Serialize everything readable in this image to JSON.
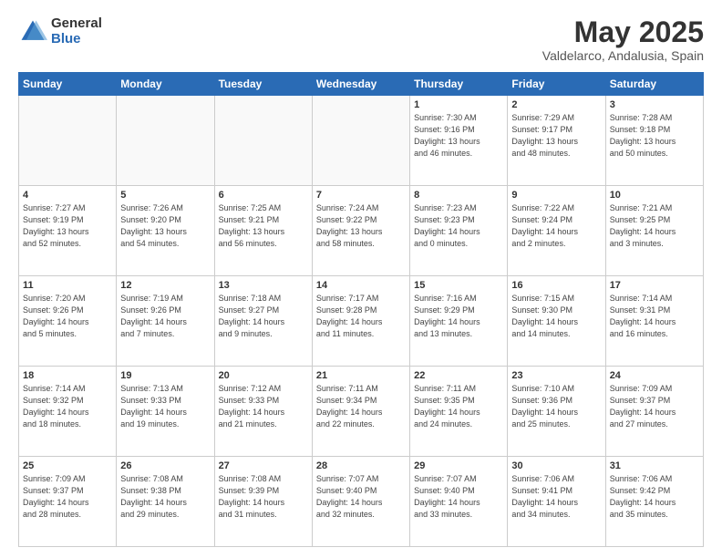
{
  "header": {
    "logo_general": "General",
    "logo_blue": "Blue",
    "title": "May 2025",
    "location": "Valdelarco, Andalusia, Spain"
  },
  "days_of_week": [
    "Sunday",
    "Monday",
    "Tuesday",
    "Wednesday",
    "Thursday",
    "Friday",
    "Saturday"
  ],
  "weeks": [
    [
      {
        "day": "",
        "info": ""
      },
      {
        "day": "",
        "info": ""
      },
      {
        "day": "",
        "info": ""
      },
      {
        "day": "",
        "info": ""
      },
      {
        "day": "1",
        "info": "Sunrise: 7:30 AM\nSunset: 9:16 PM\nDaylight: 13 hours\nand 46 minutes."
      },
      {
        "day": "2",
        "info": "Sunrise: 7:29 AM\nSunset: 9:17 PM\nDaylight: 13 hours\nand 48 minutes."
      },
      {
        "day": "3",
        "info": "Sunrise: 7:28 AM\nSunset: 9:18 PM\nDaylight: 13 hours\nand 50 minutes."
      }
    ],
    [
      {
        "day": "4",
        "info": "Sunrise: 7:27 AM\nSunset: 9:19 PM\nDaylight: 13 hours\nand 52 minutes."
      },
      {
        "day": "5",
        "info": "Sunrise: 7:26 AM\nSunset: 9:20 PM\nDaylight: 13 hours\nand 54 minutes."
      },
      {
        "day": "6",
        "info": "Sunrise: 7:25 AM\nSunset: 9:21 PM\nDaylight: 13 hours\nand 56 minutes."
      },
      {
        "day": "7",
        "info": "Sunrise: 7:24 AM\nSunset: 9:22 PM\nDaylight: 13 hours\nand 58 minutes."
      },
      {
        "day": "8",
        "info": "Sunrise: 7:23 AM\nSunset: 9:23 PM\nDaylight: 14 hours\nand 0 minutes."
      },
      {
        "day": "9",
        "info": "Sunrise: 7:22 AM\nSunset: 9:24 PM\nDaylight: 14 hours\nand 2 minutes."
      },
      {
        "day": "10",
        "info": "Sunrise: 7:21 AM\nSunset: 9:25 PM\nDaylight: 14 hours\nand 3 minutes."
      }
    ],
    [
      {
        "day": "11",
        "info": "Sunrise: 7:20 AM\nSunset: 9:26 PM\nDaylight: 14 hours\nand 5 minutes."
      },
      {
        "day": "12",
        "info": "Sunrise: 7:19 AM\nSunset: 9:26 PM\nDaylight: 14 hours\nand 7 minutes."
      },
      {
        "day": "13",
        "info": "Sunrise: 7:18 AM\nSunset: 9:27 PM\nDaylight: 14 hours\nand 9 minutes."
      },
      {
        "day": "14",
        "info": "Sunrise: 7:17 AM\nSunset: 9:28 PM\nDaylight: 14 hours\nand 11 minutes."
      },
      {
        "day": "15",
        "info": "Sunrise: 7:16 AM\nSunset: 9:29 PM\nDaylight: 14 hours\nand 13 minutes."
      },
      {
        "day": "16",
        "info": "Sunrise: 7:15 AM\nSunset: 9:30 PM\nDaylight: 14 hours\nand 14 minutes."
      },
      {
        "day": "17",
        "info": "Sunrise: 7:14 AM\nSunset: 9:31 PM\nDaylight: 14 hours\nand 16 minutes."
      }
    ],
    [
      {
        "day": "18",
        "info": "Sunrise: 7:14 AM\nSunset: 9:32 PM\nDaylight: 14 hours\nand 18 minutes."
      },
      {
        "day": "19",
        "info": "Sunrise: 7:13 AM\nSunset: 9:33 PM\nDaylight: 14 hours\nand 19 minutes."
      },
      {
        "day": "20",
        "info": "Sunrise: 7:12 AM\nSunset: 9:33 PM\nDaylight: 14 hours\nand 21 minutes."
      },
      {
        "day": "21",
        "info": "Sunrise: 7:11 AM\nSunset: 9:34 PM\nDaylight: 14 hours\nand 22 minutes."
      },
      {
        "day": "22",
        "info": "Sunrise: 7:11 AM\nSunset: 9:35 PM\nDaylight: 14 hours\nand 24 minutes."
      },
      {
        "day": "23",
        "info": "Sunrise: 7:10 AM\nSunset: 9:36 PM\nDaylight: 14 hours\nand 25 minutes."
      },
      {
        "day": "24",
        "info": "Sunrise: 7:09 AM\nSunset: 9:37 PM\nDaylight: 14 hours\nand 27 minutes."
      }
    ],
    [
      {
        "day": "25",
        "info": "Sunrise: 7:09 AM\nSunset: 9:37 PM\nDaylight: 14 hours\nand 28 minutes."
      },
      {
        "day": "26",
        "info": "Sunrise: 7:08 AM\nSunset: 9:38 PM\nDaylight: 14 hours\nand 29 minutes."
      },
      {
        "day": "27",
        "info": "Sunrise: 7:08 AM\nSunset: 9:39 PM\nDaylight: 14 hours\nand 31 minutes."
      },
      {
        "day": "28",
        "info": "Sunrise: 7:07 AM\nSunset: 9:40 PM\nDaylight: 14 hours\nand 32 minutes."
      },
      {
        "day": "29",
        "info": "Sunrise: 7:07 AM\nSunset: 9:40 PM\nDaylight: 14 hours\nand 33 minutes."
      },
      {
        "day": "30",
        "info": "Sunrise: 7:06 AM\nSunset: 9:41 PM\nDaylight: 14 hours\nand 34 minutes."
      },
      {
        "day": "31",
        "info": "Sunrise: 7:06 AM\nSunset: 9:42 PM\nDaylight: 14 hours\nand 35 minutes."
      }
    ]
  ]
}
